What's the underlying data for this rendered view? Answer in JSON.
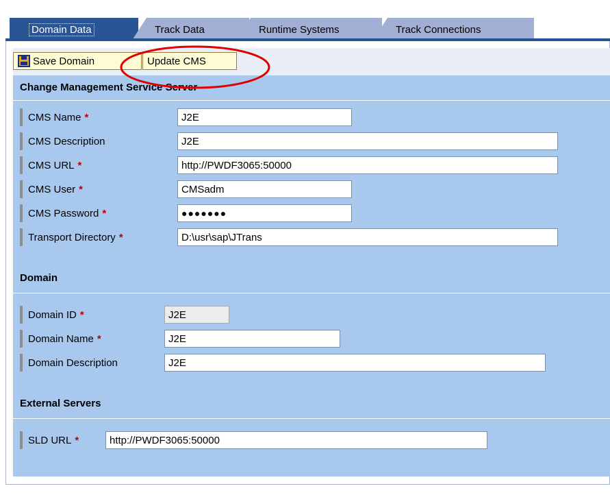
{
  "tabs": [
    {
      "label": "Domain Data",
      "active": true
    },
    {
      "label": "Track Data",
      "active": false
    },
    {
      "label": "Runtime Systems",
      "active": false
    },
    {
      "label": "Track Connections",
      "active": false
    }
  ],
  "toolbar": {
    "save_label": "Save Domain",
    "update_label": "Update CMS"
  },
  "cms_section": {
    "title": "Change Management Service Server",
    "fields": [
      {
        "label": "CMS Name",
        "required": "*",
        "value": "J2E"
      },
      {
        "label": "CMS Description",
        "required": "",
        "value": "J2E"
      },
      {
        "label": "CMS URL",
        "required": "*",
        "value": "http://PWDF3065:50000"
      },
      {
        "label": "CMS User",
        "required": "*",
        "value": "CMSadm"
      },
      {
        "label": "CMS Password",
        "required": "*",
        "value": "●●●●●●●"
      },
      {
        "label": "Transport Directory",
        "required": "*",
        "value": "D:\\usr\\sap\\JTrans"
      }
    ]
  },
  "domain_section": {
    "title": "Domain",
    "fields": [
      {
        "label": "Domain ID",
        "required": "*",
        "value": "J2E"
      },
      {
        "label": "Domain Name",
        "required": "*",
        "value": "J2E"
      },
      {
        "label": "Domain Description",
        "required": "",
        "value": "J2E"
      }
    ]
  },
  "external_section": {
    "title": "External Servers",
    "fields": [
      {
        "label": "SLD URL",
        "required": "*",
        "value": "http://PWDF3065:50000"
      }
    ]
  },
  "colors": {
    "active_tab": "#295595",
    "inactive_tab": "#a2afd4",
    "panel_bg": "#a8c8ee",
    "required_marker": "#c00000",
    "annotation_circle": "#e00000"
  },
  "icons": {
    "save": "floppy-disk-icon"
  }
}
